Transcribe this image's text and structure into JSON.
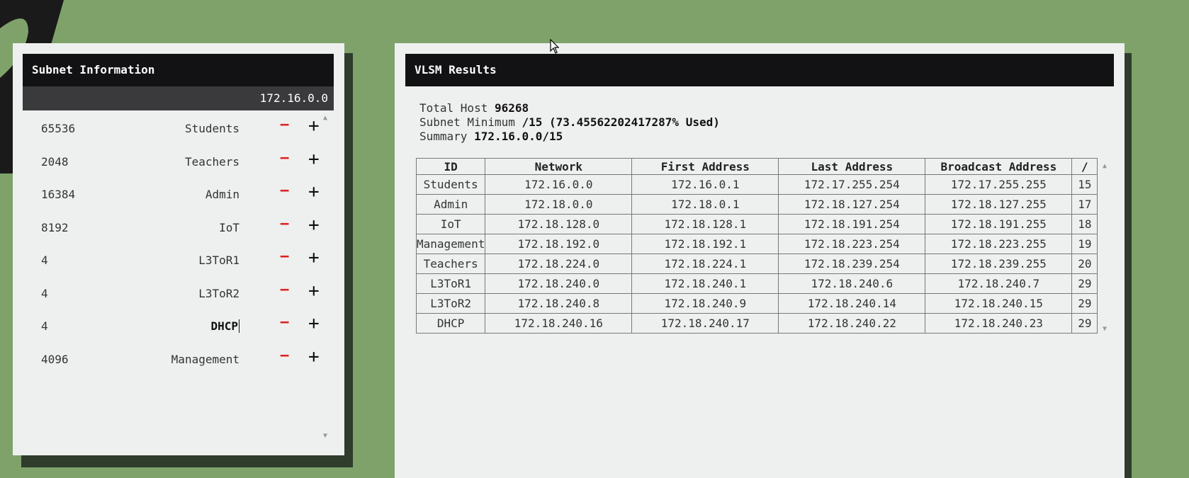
{
  "left_panel": {
    "title": "Subnet Information",
    "network_address": "172.16.0.0",
    "subnets": [
      {
        "hosts": "65536",
        "name": "Students"
      },
      {
        "hosts": "2048",
        "name": "Teachers"
      },
      {
        "hosts": "16384",
        "name": "Admin"
      },
      {
        "hosts": "8192",
        "name": "IoT"
      },
      {
        "hosts": "4",
        "name": "L3ToR1"
      },
      {
        "hosts": "4",
        "name": "L3ToR2"
      },
      {
        "hosts": "4",
        "name": "DHCP"
      },
      {
        "hosts": "4096",
        "name": "Management"
      }
    ],
    "minus_label": "−",
    "plus_label": "+"
  },
  "right_panel": {
    "title": "VLSM Results",
    "total_host_label": "Total Host",
    "total_host_value": "96268",
    "subnet_minimum_label": "Subnet Minimum",
    "subnet_minimum_value": "/15 (73.45562202417287% Used)",
    "summary_label": "Summary",
    "summary_value": "172.16.0.0/15",
    "table": {
      "headers": [
        "ID",
        "Network",
        "First Address",
        "Last Address",
        "Broadcast Address",
        "/"
      ],
      "rows": [
        [
          "Students",
          "172.16.0.0",
          "172.16.0.1",
          "172.17.255.254",
          "172.17.255.255",
          "15"
        ],
        [
          "Admin",
          "172.18.0.0",
          "172.18.0.1",
          "172.18.127.254",
          "172.18.127.255",
          "17"
        ],
        [
          "IoT",
          "172.18.128.0",
          "172.18.128.1",
          "172.18.191.254",
          "172.18.191.255",
          "18"
        ],
        [
          "Management",
          "172.18.192.0",
          "172.18.192.1",
          "172.18.223.254",
          "172.18.223.255",
          "19"
        ],
        [
          "Teachers",
          "172.18.224.0",
          "172.18.224.1",
          "172.18.239.254",
          "172.18.239.255",
          "20"
        ],
        [
          "L3ToR1",
          "172.18.240.0",
          "172.18.240.1",
          "172.18.240.6",
          "172.18.240.7",
          "29"
        ],
        [
          "L3ToR2",
          "172.18.240.8",
          "172.18.240.9",
          "172.18.240.14",
          "172.18.240.15",
          "29"
        ],
        [
          "DHCP",
          "172.18.240.16",
          "172.18.240.17",
          "172.18.240.22",
          "172.18.240.23",
          "29"
        ]
      ]
    }
  },
  "colors": {
    "background": "#7fa26a",
    "panel": "#eef0ef",
    "header": "#121214",
    "minus": "#dd2222"
  }
}
